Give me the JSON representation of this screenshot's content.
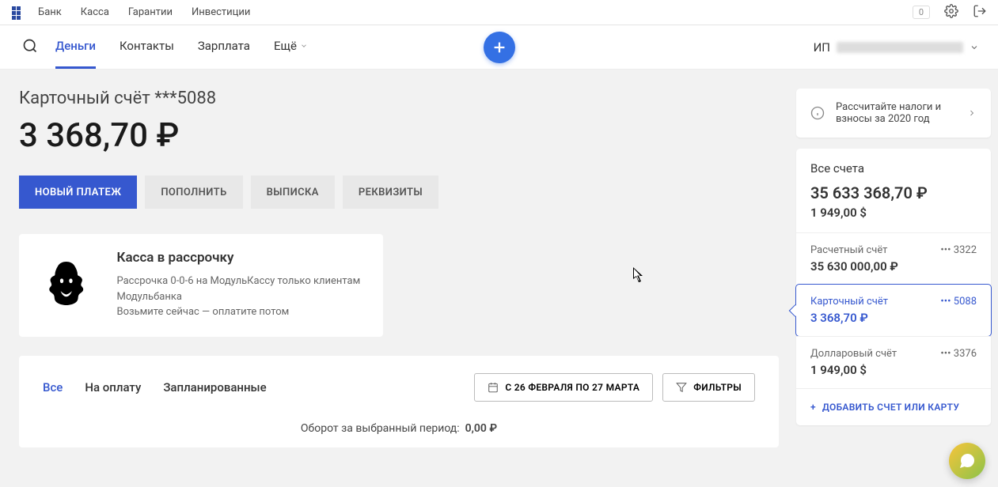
{
  "topnav": [
    "Банк",
    "Касса",
    "Гарантии",
    "Инвестиции"
  ],
  "notif_count": "0",
  "mainnav": {
    "items": [
      "Деньги",
      "Контакты",
      "Зарплата"
    ],
    "more": "Ещё",
    "active": 0
  },
  "user_prefix": "ИП",
  "account": {
    "title": "Карточный счёт ***5088",
    "balance": "3 368,70 ₽",
    "actions": {
      "new_payment": "НОВЫЙ ПЛАТЕЖ",
      "topup": "ПОПОЛНИТЬ",
      "statement": "ВЫПИСКА",
      "details": "РЕКВИЗИТЫ"
    }
  },
  "promo": {
    "title": "Касса в рассрочку",
    "line1": "Рассрочка 0-0-6 на МодульКассу только клиентам Модульбанка",
    "line2": "Возьмите сейчас — оплатите потом"
  },
  "txn": {
    "tabs": [
      "Все",
      "На оплату",
      "Запланированные"
    ],
    "active": 0,
    "date_btn": "С 26 ФЕВРАЛЯ ПО 27 МАРТА",
    "filter_btn": "ФИЛЬТРЫ",
    "turnover_label": "Оборот за выбранный период:",
    "turnover_value": "0,00 ₽"
  },
  "side": {
    "tax_notice": "Рассчитайте налоги и взносы за 2020 год",
    "all_title": "Все счета",
    "all_rub": "35 633 368,70 ₽",
    "all_usd": "1 949,00 $",
    "accounts": [
      {
        "name": "Расчетный счёт",
        "mask": "••• 3322",
        "balance": "35 630 000,00 ₽",
        "selected": false
      },
      {
        "name": "Карточный счёт",
        "mask": "••• 5088",
        "balance": "3 368,70 ₽",
        "selected": true
      },
      {
        "name": "Долларовый счёт",
        "mask": "••• 3376",
        "balance": "1 949,00 $",
        "selected": false
      }
    ],
    "add_account": "ДОБАВИТЬ СЧЕТ ИЛИ КАРТУ"
  }
}
